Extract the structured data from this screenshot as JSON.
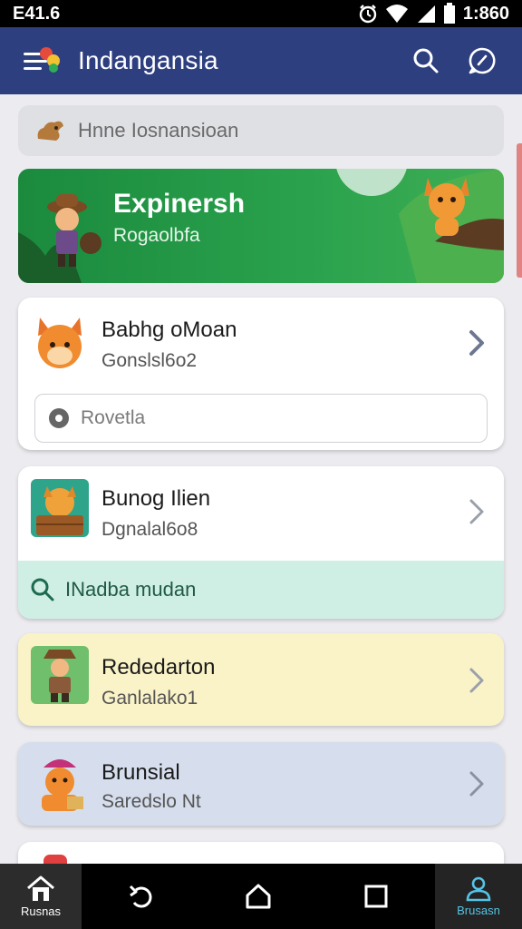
{
  "status_bar": {
    "time_left": "E41.6",
    "time_right": "1:860"
  },
  "app_bar": {
    "title": "Indangansia"
  },
  "search": {
    "text": "Hnne Iosnansioan"
  },
  "banner": {
    "title": "Expinersh",
    "subtitle": "Rogaolbfa"
  },
  "cards": [
    {
      "title": "Babhg oMoan",
      "subtitle": "Gonslsl6o2",
      "input": "Rovetla"
    },
    {
      "title": "Bunog Ilien",
      "subtitle": "Dgnalal6o8",
      "action": "INadba mudan"
    },
    {
      "title": "Rededarton",
      "subtitle": "Ganlalako1"
    },
    {
      "title": "Brunsial",
      "subtitle": "Saredslo Nt"
    }
  ],
  "nav": {
    "home_label": "Rusnas",
    "profile_label": "Brusasn"
  },
  "colors": {
    "app_bar": "#2e3f80",
    "banner": "#22983f",
    "card_yellow": "#faf3c7",
    "card_blue": "#d6deed",
    "strip": "#cfeee4"
  }
}
